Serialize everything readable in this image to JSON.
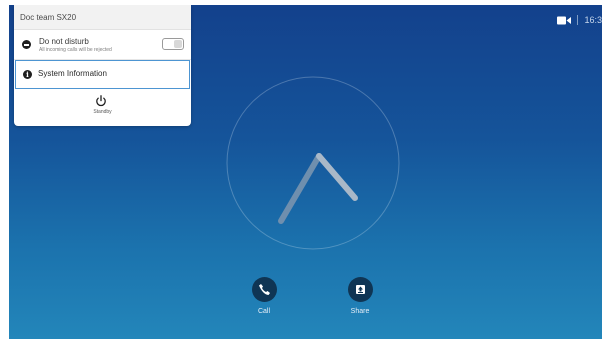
{
  "status": {
    "time": "16:3",
    "camera_icon": "video-camera-icon"
  },
  "panel": {
    "title": "Doc team SX20",
    "do_not_disturb": {
      "label": "Do not disturb",
      "sublabel": "All incoming calls will be rejected",
      "icon": "minus-circle-icon",
      "enabled": false
    },
    "system_information": {
      "label": "System Information",
      "icon": "info-circle-icon"
    },
    "standby": {
      "label": "Standby",
      "icon": "power-icon"
    }
  },
  "swipe_icon": "chevron-up-icon",
  "actions": {
    "call": {
      "label": "Call",
      "icon": "phone-icon"
    },
    "share": {
      "label": "Share",
      "icon": "share-upload-icon"
    }
  },
  "colors": {
    "background_top": "#13418c",
    "background_bottom": "#2386ba",
    "button": "#0f3554",
    "focus_border": "#4d95d2"
  }
}
